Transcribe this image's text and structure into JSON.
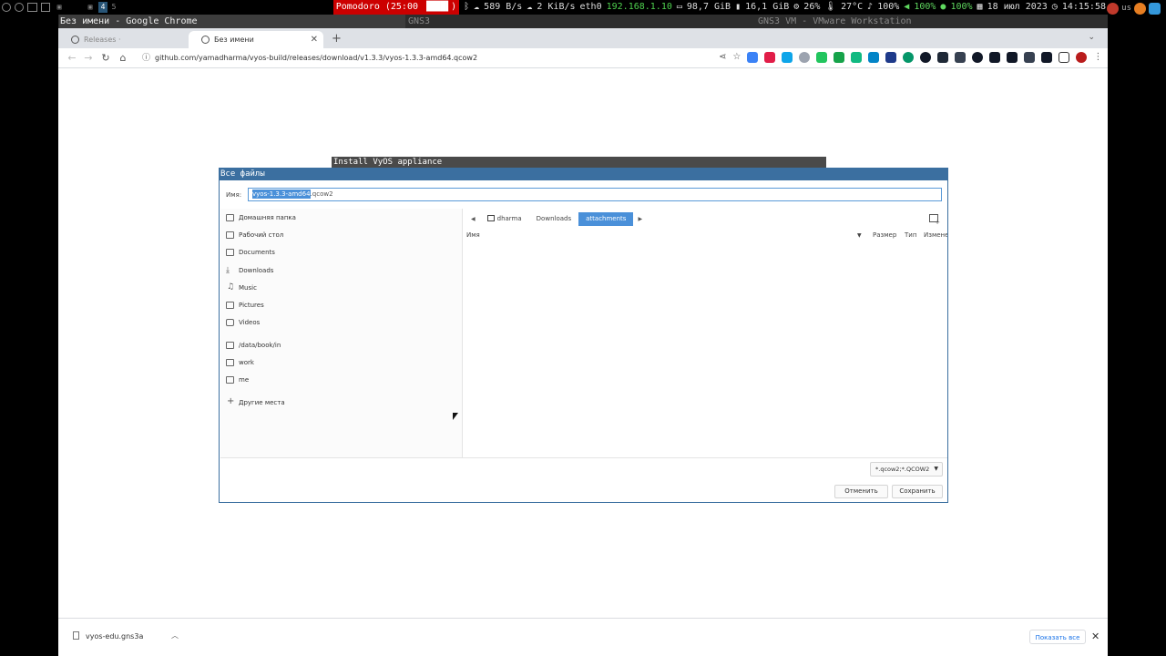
{
  "sysbar": {
    "workspaces": [
      "4",
      "5"
    ],
    "pomodoro": "Pomodoro (25:00 ▐███▌)",
    "download_rate": "589 B/s",
    "upload_rate": "2 KiB/s",
    "iface": "eth0",
    "ip": "192.168.1.10",
    "disk1": "98,7 GiB",
    "disk2": "16,1 GiB",
    "cpu": "26%",
    "temp": "27°C",
    "volume": "100%",
    "speaker": "100%",
    "mic": "100%",
    "date": "18 июл 2023",
    "time": "14:15:58",
    "layout": "us"
  },
  "titlebar": {
    "active": "Без имени - Google Chrome",
    "second": "GNS3",
    "third": "GNS3 VM - VMware Workstation"
  },
  "browser": {
    "tabs": [
      {
        "label": "Releases · yamadharma/vyos-b"
      },
      {
        "label": "Без имени"
      }
    ],
    "url": "github.com/yamadharma/vyos-build/releases/download/v1.3.3/vyos-1.3.3-amd64.qcow2",
    "ext_colors": [
      "#3b82f6",
      "#e11d48",
      "#0ea5e9",
      "#9ca3af",
      "#22c55e",
      "#16a34a",
      "#10b981",
      "#0284c7",
      "#1e3a8a",
      "#059669",
      "#111827",
      "#1f2937",
      "#374151",
      "#111827",
      "#111827",
      "#111827",
      "#111827",
      "#374151",
      "#111827",
      "#b91c1c"
    ]
  },
  "gns3": {
    "dialog_title": "Install VyOS appliance"
  },
  "dialog": {
    "title": "Все файлы",
    "name_label": "Имя:",
    "filename_selected": "vyos-1.3.3-amd64",
    "filename_rest": ".qcow2",
    "places": [
      {
        "label": "Домашняя папка",
        "icon": "home-icon"
      },
      {
        "label": "Рабочий стол",
        "icon": "desktop-icon"
      },
      {
        "label": "Documents",
        "icon": "folder-icon"
      },
      {
        "label": "Downloads",
        "icon": "download-icon"
      },
      {
        "label": "Music",
        "icon": "music-icon"
      },
      {
        "label": "Pictures",
        "icon": "picture-icon"
      },
      {
        "label": "Videos",
        "icon": "video-icon"
      },
      {
        "label": "/data/book/in",
        "icon": "folder-icon"
      },
      {
        "label": "work",
        "icon": "folder-icon"
      },
      {
        "label": "me",
        "icon": "folder-icon"
      },
      {
        "label": "Другие места",
        "icon": "plus-icon"
      }
    ],
    "breadcrumbs": [
      "dharma",
      "Downloads",
      "attachments"
    ],
    "columns": {
      "name": "Имя",
      "size": "Размер",
      "type": "Тип",
      "modified": "Изменен"
    },
    "filter": "*.qcow2;*.QCOW2",
    "cancel": "Отменить",
    "save": "Сохранить"
  },
  "shelf": {
    "download": "vyos-edu.gns3a",
    "show_all": "Показать все"
  }
}
